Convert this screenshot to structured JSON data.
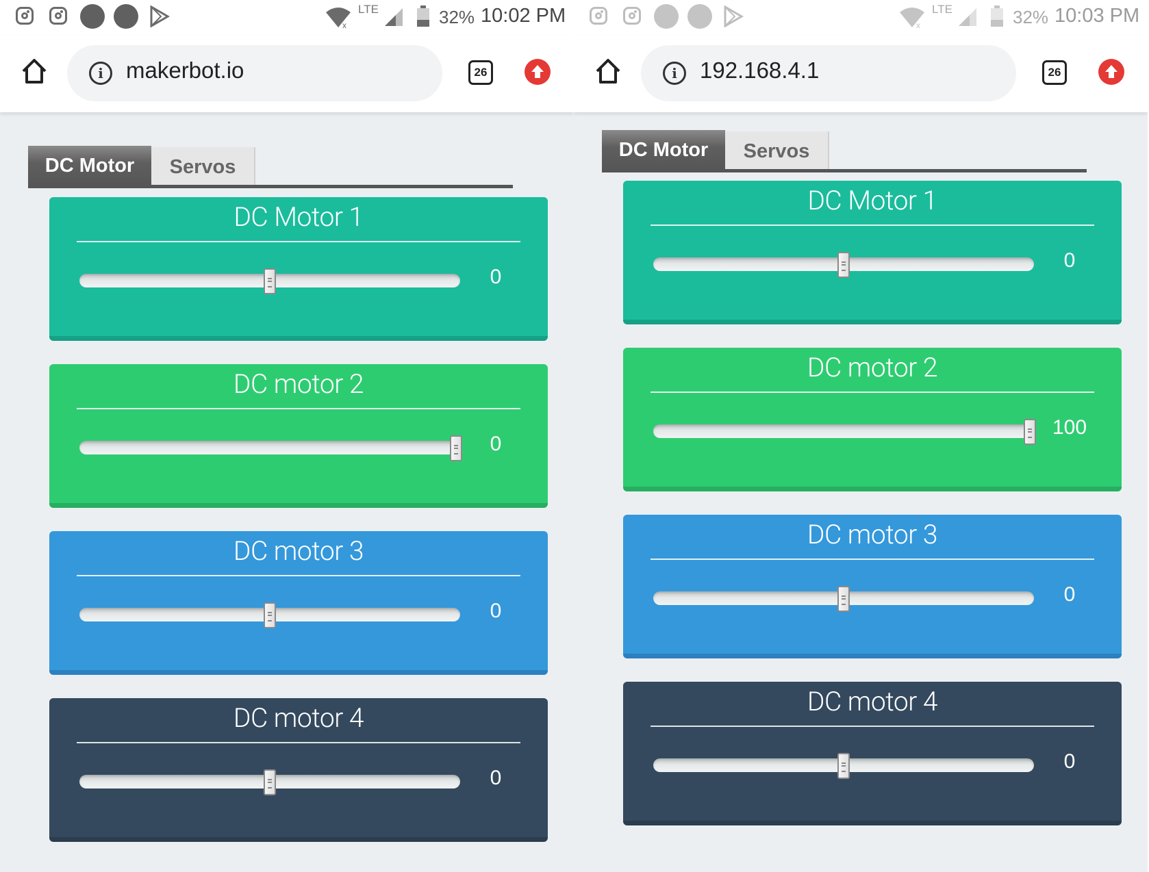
{
  "panels": [
    {
      "status": {
        "battery": "32%",
        "time": "10:02 PM",
        "network": "LTE"
      },
      "url": "makerbot.io",
      "tab_count": "26",
      "tabs": [
        {
          "label": "DC Motor",
          "active": true
        },
        {
          "label": "Servos",
          "active": false
        }
      ],
      "motors": [
        {
          "title": "DC Motor 1",
          "value": "0",
          "slider_fraction": 0.5,
          "color": "#1abc9c",
          "shade": "#16a085"
        },
        {
          "title": "DC motor 2",
          "value": "0",
          "slider_fraction": 0.99,
          "color": "#2ecc71",
          "shade": "#27ae60"
        },
        {
          "title": "DC motor 3",
          "value": "0",
          "slider_fraction": 0.5,
          "color": "#3498db",
          "shade": "#2c80c0"
        },
        {
          "title": "DC motor 4",
          "value": "0",
          "slider_fraction": 0.5,
          "color": "#34495e",
          "shade": "#2b3d4f"
        }
      ]
    },
    {
      "status": {
        "battery": "32%",
        "time": "10:03 PM",
        "network": "LTE"
      },
      "url": "192.168.4.1",
      "tab_count": "26",
      "tabs": [
        {
          "label": "DC Motor",
          "active": true
        },
        {
          "label": "Servos",
          "active": false
        }
      ],
      "motors": [
        {
          "title": "DC Motor 1",
          "value": "0",
          "slider_fraction": 0.5,
          "color": "#1abc9c",
          "shade": "#16a085"
        },
        {
          "title": "DC motor 2",
          "value": "100",
          "slider_fraction": 0.99,
          "color": "#2ecc71",
          "shade": "#27ae60"
        },
        {
          "title": "DC motor 3",
          "value": "0",
          "slider_fraction": 0.5,
          "color": "#3498db",
          "shade": "#2c80c0"
        },
        {
          "title": "DC motor 4",
          "value": "0",
          "slider_fraction": 0.5,
          "color": "#34495e",
          "shade": "#2b3d4f"
        }
      ]
    }
  ]
}
